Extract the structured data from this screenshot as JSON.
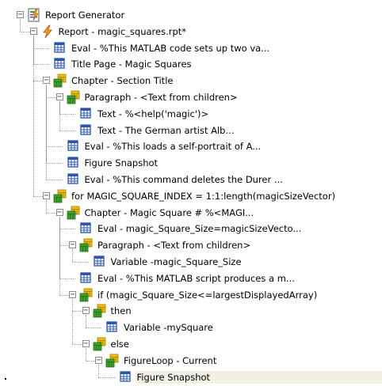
{
  "tree": {
    "nodes": [
      {
        "label": "Report Generator",
        "depth": 0,
        "expander": "minus",
        "icon": "report-generator-icon",
        "name": "tree-node-report-generator"
      },
      {
        "label": "Report - magic_squares.rpt*",
        "depth": 1,
        "expander": "minus",
        "icon": "lightning-report-icon",
        "name": "tree-node-report"
      },
      {
        "label": "Eval - %This MATLAB code sets up two va...",
        "depth": 2,
        "expander": "none",
        "icon": "component-icon",
        "name": "tree-node-eval-setup"
      },
      {
        "label": "Title Page - Magic Squares",
        "depth": 2,
        "expander": "none",
        "icon": "component-icon",
        "name": "tree-node-title-page"
      },
      {
        "label": "Chapter - Section Title",
        "depth": 2,
        "expander": "minus",
        "icon": "group-component-icon",
        "name": "tree-node-chapter-section-title"
      },
      {
        "label": "Paragraph - <Text from children>",
        "depth": 3,
        "expander": "minus",
        "icon": "group-component-icon",
        "name": "tree-node-paragraph-1"
      },
      {
        "label": "Text - %<help('magic')>",
        "depth": 4,
        "expander": "none",
        "icon": "component-icon",
        "name": "tree-node-text-help"
      },
      {
        "label": "Text - The German artist Alb...",
        "depth": 4,
        "expander": "none",
        "icon": "component-icon",
        "name": "tree-node-text-german-artist"
      },
      {
        "label": "Eval - %This loads a self-portrait of A...",
        "depth": 3,
        "expander": "none",
        "icon": "component-icon",
        "name": "tree-node-eval-self-portrait"
      },
      {
        "label": "Figure Snapshot",
        "depth": 3,
        "expander": "none",
        "icon": "component-icon",
        "name": "tree-node-figure-snapshot-1"
      },
      {
        "label": "Eval - %This command deletes the Durer ...",
        "depth": 3,
        "expander": "none",
        "icon": "component-icon",
        "name": "tree-node-eval-delete-durer"
      },
      {
        "label": "for MAGIC_SQUARE_INDEX = 1:1:length(magicSizeVector)",
        "depth": 2,
        "expander": "minus",
        "icon": "group-component-icon",
        "name": "tree-node-for-loop"
      },
      {
        "label": "Chapter - Magic Square # %<MAGI...",
        "depth": 3,
        "expander": "minus",
        "icon": "group-component-icon",
        "name": "tree-node-chapter-magic-square"
      },
      {
        "label": "Eval - magic_Square_Size=magicSizeVecto...",
        "depth": 4,
        "expander": "none",
        "icon": "component-icon",
        "name": "tree-node-eval-square-size"
      },
      {
        "label": "Paragraph - <Text from children>",
        "depth": 4,
        "expander": "minus",
        "icon": "group-component-icon",
        "name": "tree-node-paragraph-2"
      },
      {
        "label": "Variable -magic_Square_Size",
        "depth": 5,
        "expander": "none",
        "icon": "component-icon",
        "name": "tree-node-variable-square-size"
      },
      {
        "label": "Eval - %This MATLAB script produces a m...",
        "depth": 4,
        "expander": "none",
        "icon": "component-icon",
        "name": "tree-node-eval-script"
      },
      {
        "label": "if (magic_Square_Size<=largestDisplayedArray)",
        "depth": 4,
        "expander": "minus",
        "icon": "group-component-icon",
        "name": "tree-node-if"
      },
      {
        "label": "then",
        "depth": 5,
        "expander": "minus",
        "icon": "group-component-icon",
        "name": "tree-node-then"
      },
      {
        "label": "Variable -mySquare",
        "depth": 6,
        "expander": "none",
        "icon": "component-icon",
        "name": "tree-node-variable-mysquare"
      },
      {
        "label": "else",
        "depth": 5,
        "expander": "minus",
        "icon": "group-component-icon",
        "name": "tree-node-else"
      },
      {
        "label": "FigureLoop - Current",
        "depth": 6,
        "expander": "minus",
        "icon": "group-component-icon",
        "name": "tree-node-figure-loop"
      },
      {
        "label": "Figure Snapshot",
        "depth": 7,
        "expander": "none",
        "icon": "component-icon",
        "name": "tree-node-figure-snapshot-2",
        "selected": true
      }
    ]
  },
  "colors": {
    "selection": "#f2efe4",
    "expander_border": "#8c8c8c",
    "connector": "#9a9a9a",
    "component_blue": "#2a55b5",
    "group_yellow": "#f2c200",
    "group_green": "#3f9f2f",
    "lightning": "#e8a800"
  }
}
